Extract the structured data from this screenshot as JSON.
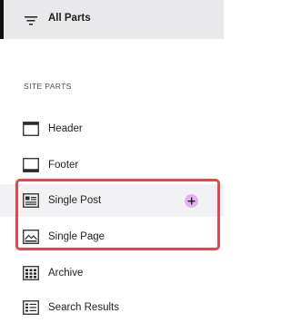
{
  "header": {
    "label": "All Parts",
    "icon": "filter-list-icon"
  },
  "section": {
    "title": "SITE PARTS"
  },
  "items": [
    {
      "label": "Header",
      "icon": "header-layout-icon"
    },
    {
      "label": "Footer",
      "icon": "footer-layout-icon"
    },
    {
      "label": "Single Post",
      "icon": "single-post-icon",
      "action": "plus-icon"
    },
    {
      "label": "Single Page",
      "icon": "single-page-icon"
    },
    {
      "label": "Archive",
      "icon": "archive-grid-icon"
    },
    {
      "label": "Search Results",
      "icon": "search-results-icon"
    }
  ],
  "colors": {
    "accent_highlight": "#e4464e",
    "add_button": "#e3b2ee",
    "active_background": "#e9e9ec"
  }
}
